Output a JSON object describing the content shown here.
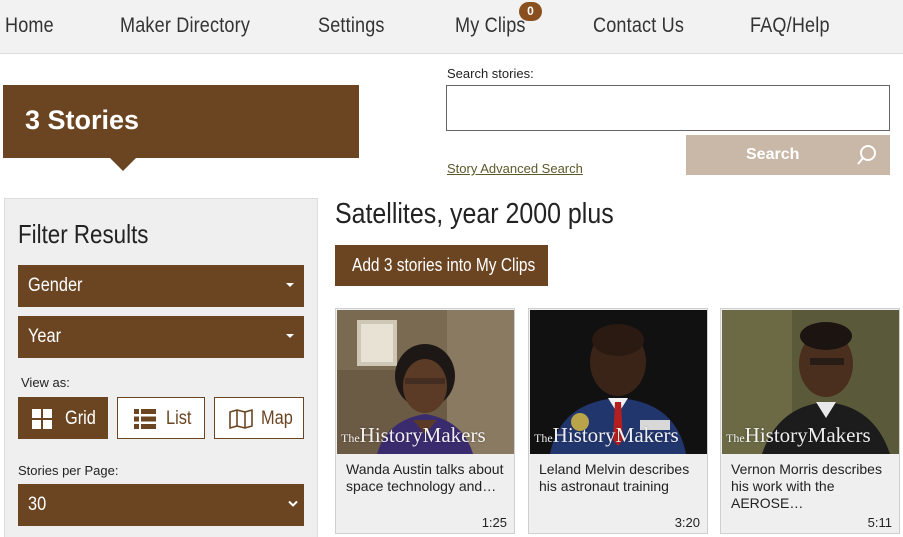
{
  "nav": {
    "items": [
      {
        "label": "Home"
      },
      {
        "label": "Maker Directory"
      },
      {
        "label": "Settings"
      },
      {
        "label": "My Clips"
      },
      {
        "label": "Contact Us"
      },
      {
        "label": "FAQ/Help"
      }
    ],
    "clips_badge": "0"
  },
  "banner": {
    "text": "3 Stories"
  },
  "search": {
    "label": "Search stories:",
    "value": "",
    "button_label": "Search",
    "advanced_link": "Story Advanced Search",
    "button_icon": "search-icon"
  },
  "filter": {
    "title": "Filter Results",
    "dropdowns": [
      {
        "label": "Gender"
      },
      {
        "label": "Year"
      }
    ],
    "view_as_label": "View as:",
    "view_options": [
      {
        "label": "Grid",
        "icon": "grid-icon",
        "active": true
      },
      {
        "label": "List",
        "icon": "list-icon",
        "active": false
      },
      {
        "label": "Map",
        "icon": "map-icon",
        "active": false
      }
    ],
    "stories_per_page_label": "Stories per Page:",
    "stories_per_page_value": "30"
  },
  "results": {
    "title": "Satellites, year 2000 plus",
    "add_button": "Add 3 stories into My Clips",
    "cards": [
      {
        "title": "Wanda Austin talks about space technology and…",
        "duration": "1:25"
      },
      {
        "title": "Leland Melvin describes his astronaut training",
        "duration": "3:20"
      },
      {
        "title": "Vernon Morris describes his work with the AEROSE…",
        "duration": "5:11"
      }
    ],
    "watermark_the": "The",
    "watermark_brand": "HistoryMakers"
  },
  "colors": {
    "brand_brown": "#6b4522",
    "search_button": "#c9b8a8",
    "badge": "#8a4f1f"
  }
}
